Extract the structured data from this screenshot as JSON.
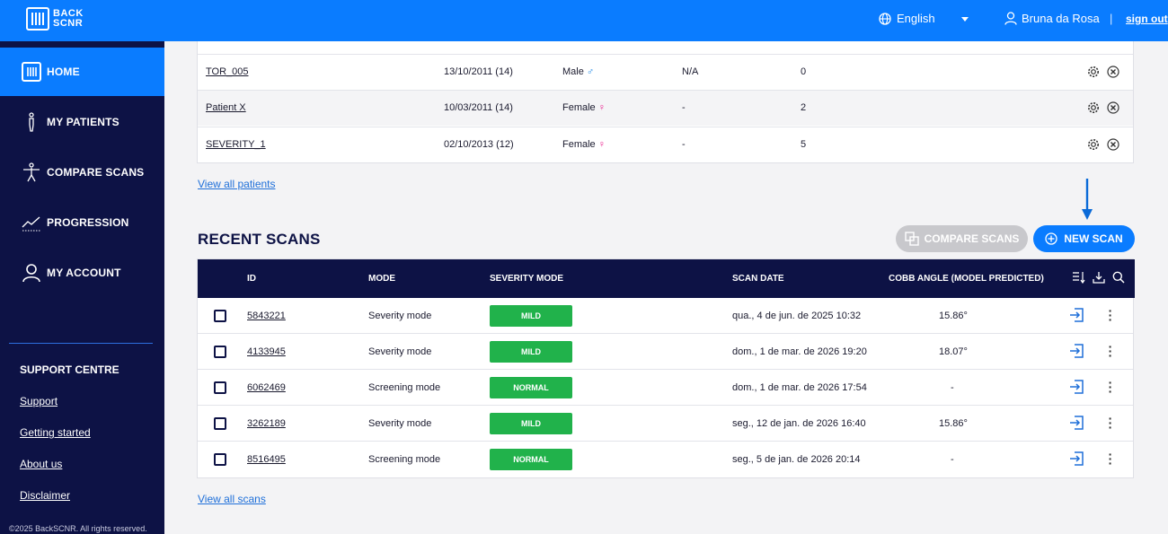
{
  "header": {
    "logo_line1": "BACK",
    "logo_line2": "SCNR",
    "language": "English",
    "user_name": "Bruna da Rosa",
    "separator": "|",
    "sign_out": "sign out"
  },
  "sidebar": {
    "items": [
      {
        "label": "HOME",
        "icon": "logo-icon"
      },
      {
        "label": "MY PATIENTS",
        "icon": "person-icon"
      },
      {
        "label": "COMPARE SCANS",
        "icon": "body-icon"
      },
      {
        "label": "PROGRESSION",
        "icon": "chart-icon"
      },
      {
        "label": "MY ACCOUNT",
        "icon": "user-icon"
      }
    ],
    "support_title": "SUPPORT CENTRE",
    "links": [
      "Support",
      "Getting started",
      "About us",
      "Disclaimer"
    ],
    "copyright": "©2025 BackSCNR. All rights reserved."
  },
  "patients": {
    "rows": [
      {
        "name": "TOR_005",
        "dob": "13/10/2011 (14)",
        "sex": "Male",
        "sex_symbol": "♂",
        "col4": "N/A",
        "scans": "0"
      },
      {
        "name": "Patient X",
        "dob": "10/03/2011 (14)",
        "sex": "Female",
        "sex_symbol": "♀",
        "col4": "-",
        "scans": "2"
      },
      {
        "name": "SEVERITY_1",
        "dob": "02/10/2013 (12)",
        "sex": "Female",
        "sex_symbol": "♀",
        "col4": "-",
        "scans": "5"
      }
    ],
    "view_all": "View all patients"
  },
  "recent_scans": {
    "title": "RECENT SCANS",
    "compare_button": "COMPARE SCANS",
    "new_scan_button": "NEW SCAN",
    "headers": {
      "id": "ID",
      "mode": "MODE",
      "severity": "SEVERITY MODE",
      "date": "SCAN DATE",
      "cobb": "COBB ANGLE (MODEL PREDICTED)"
    },
    "rows": [
      {
        "id": "5843221",
        "mode": "Severity mode",
        "severity": "MILD",
        "date": "qua., 4 de jun. de 2025 10:32",
        "cobb": "15.86°"
      },
      {
        "id": "4133945",
        "mode": "Severity mode",
        "severity": "MILD",
        "date": "dom., 1 de mar. de 2026 19:20",
        "cobb": "18.07°"
      },
      {
        "id": "6062469",
        "mode": "Screening mode",
        "severity": "NORMAL",
        "date": "dom., 1 de mar. de 2026 17:54",
        "cobb": "-"
      },
      {
        "id": "3262189",
        "mode": "Severity mode",
        "severity": "MILD",
        "date": "seg., 12 de jan. de 2026 16:40",
        "cobb": "15.86°"
      },
      {
        "id": "8516495",
        "mode": "Screening mode",
        "severity": "NORMAL",
        "date": "seg., 5 de jan. de 2026 20:14",
        "cobb": "-"
      }
    ],
    "view_all": "View all scans"
  },
  "colors": {
    "primary": "#0a7cff",
    "sidebar": "#0d1245",
    "badge_green": "#21b24b"
  }
}
